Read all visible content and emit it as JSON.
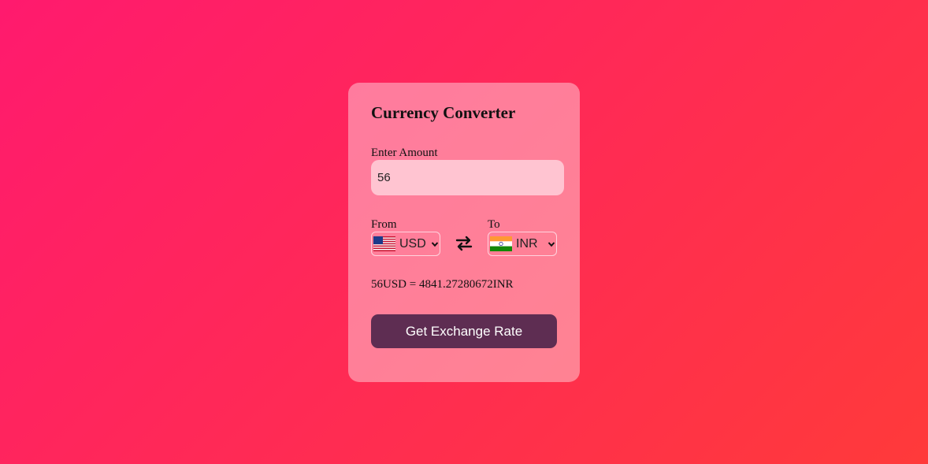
{
  "converter": {
    "title": "Currency Converter",
    "amount_label": "Enter Amount",
    "amount_value": "56",
    "from_label": "From",
    "to_label": "To",
    "from_currency": "USD",
    "to_currency": "INR",
    "result_text": "56USD = 4841.27280672INR",
    "button_label": "Get Exchange Rate"
  },
  "icons": {
    "from_flag": "us-flag-icon",
    "to_flag": "india-flag-icon",
    "swap": "swap-arrows-icon",
    "dropdown": "chevron-down-icon"
  },
  "colors": {
    "button_bg": "#5e2d52",
    "input_bg": "#ffc4d1",
    "gradient_start": "#ff1a6e",
    "gradient_end": "#ff3a3a"
  }
}
